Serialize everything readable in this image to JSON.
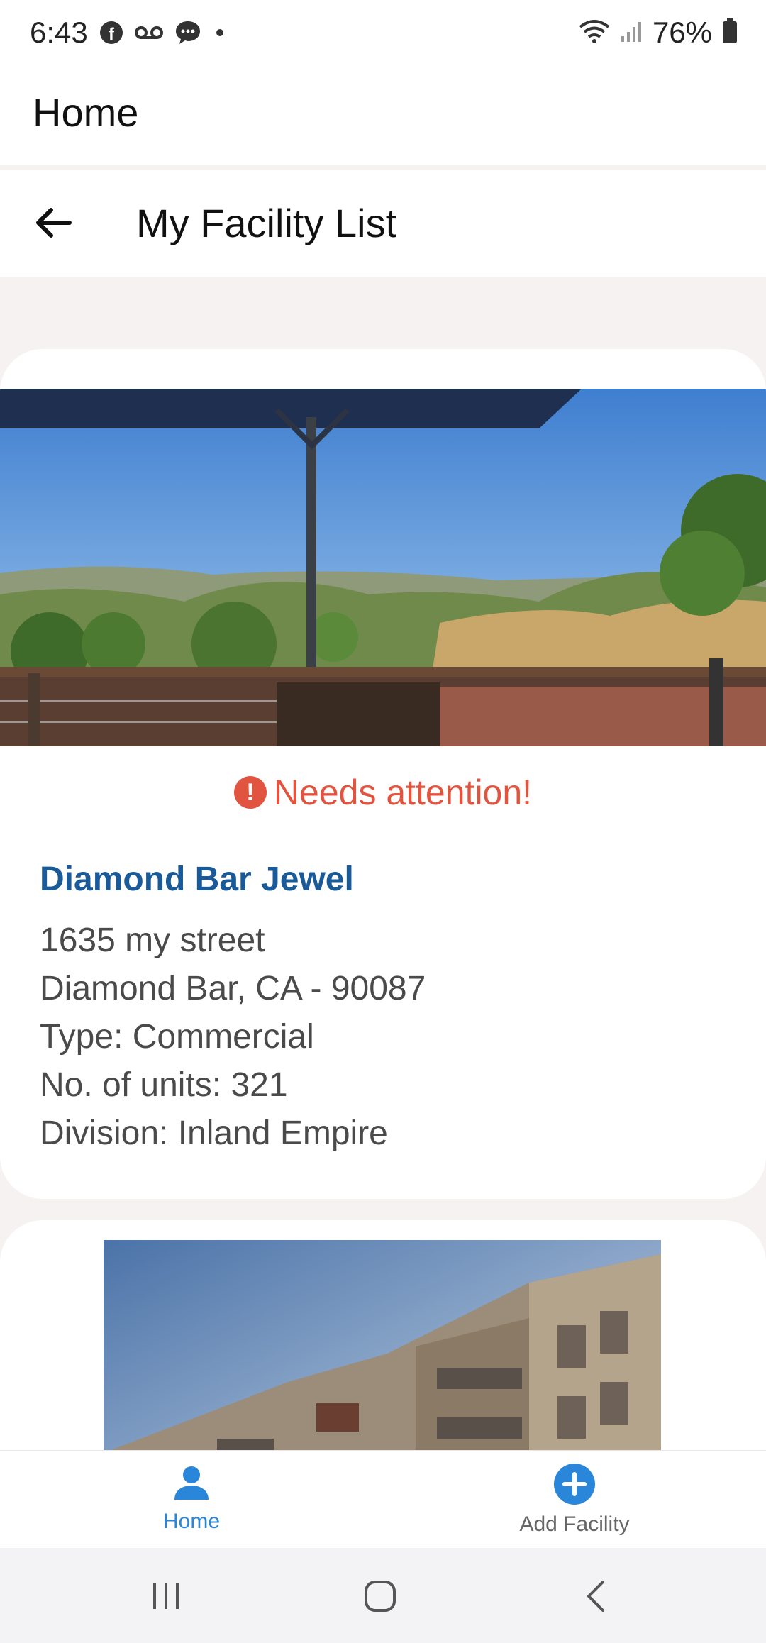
{
  "status_bar": {
    "time": "6:43",
    "battery": "76%",
    "icons": [
      "facebook-icon",
      "voicemail-icon",
      "chat-icon",
      "dot-icon",
      "wifi-icon",
      "signal-icon",
      "battery-icon"
    ]
  },
  "header": {
    "title": "Home"
  },
  "subheader": {
    "title": "My Facility List",
    "back_icon": "arrow-left-icon"
  },
  "facilities": [
    {
      "alert": "Needs attention!",
      "name": "Diamond Bar Jewel",
      "address_line1": "1635 my street",
      "address_line2": "Diamond Bar, CA - 90087",
      "type": "Type: Commercial",
      "units": "No. of units: 321",
      "division": "Division: Inland Empire"
    }
  ],
  "bottom_nav": {
    "home_label": "Home",
    "add_label": "Add Facility"
  },
  "colors": {
    "accent": "#2a86d8",
    "alert": "#e1543f",
    "facility_name": "#1a5a99"
  }
}
